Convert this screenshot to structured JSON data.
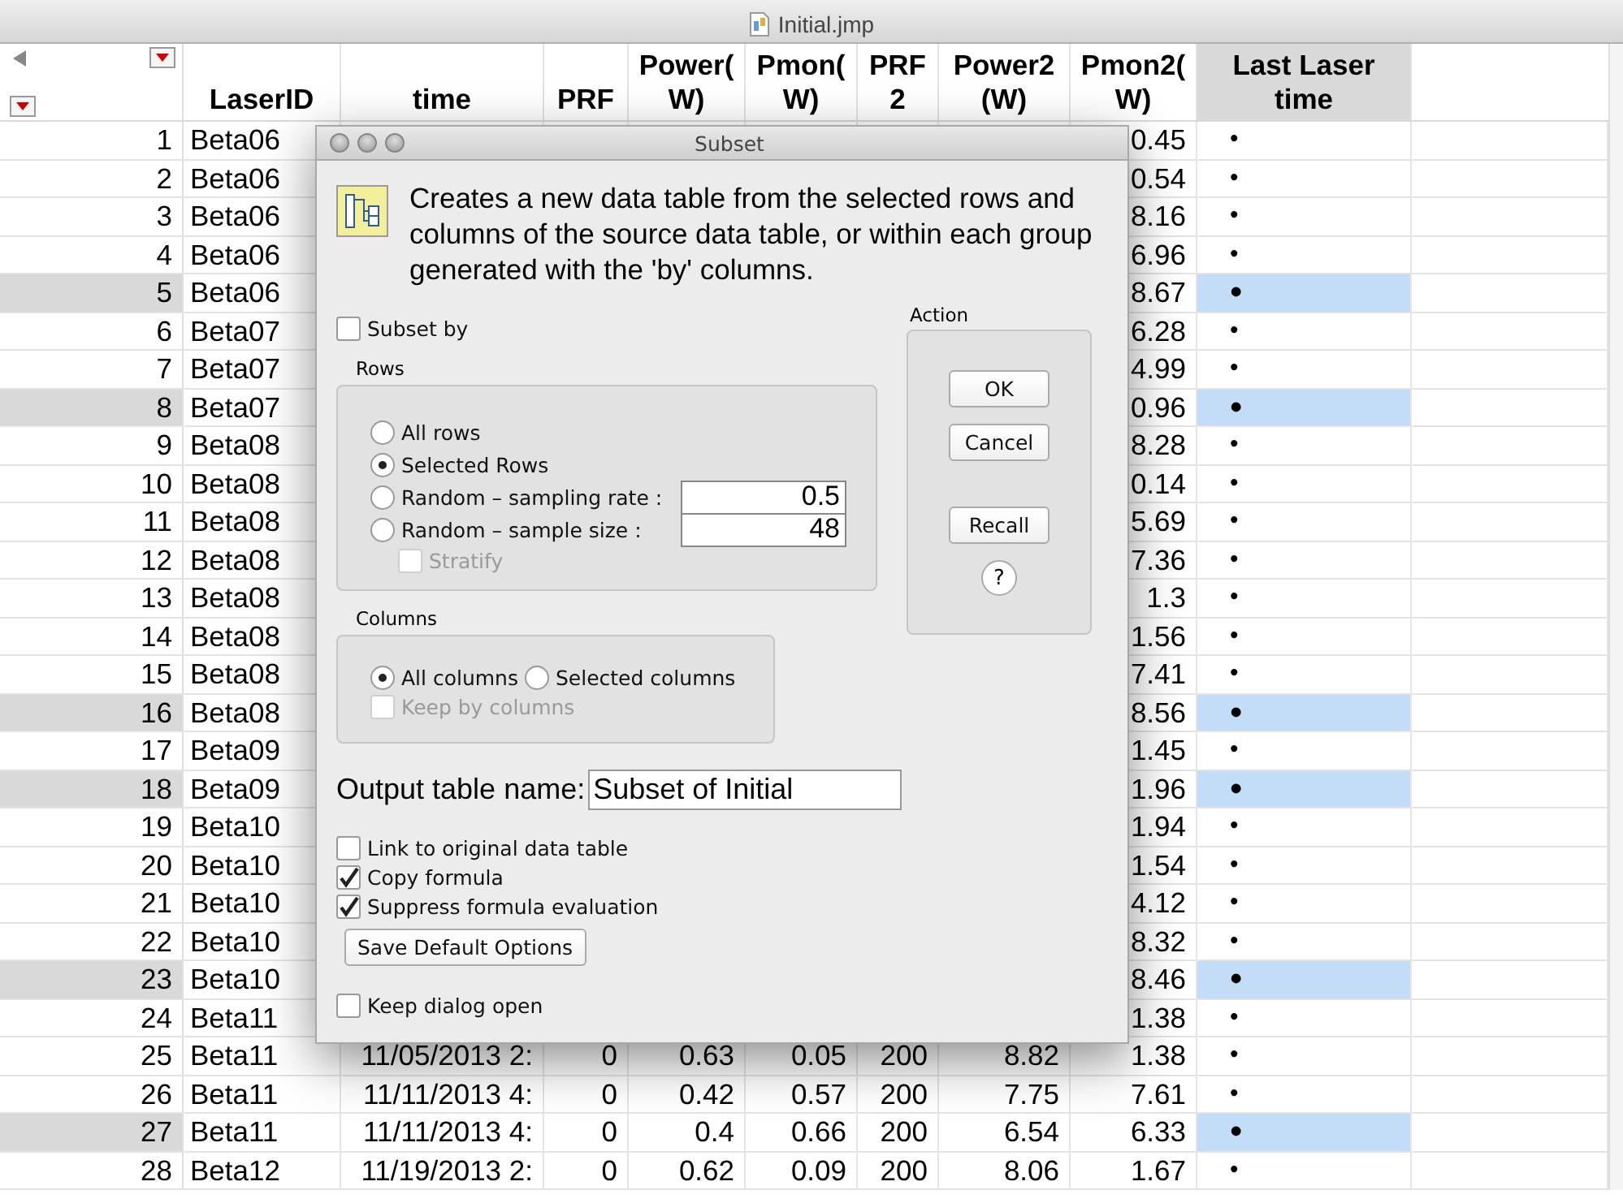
{
  "window": {
    "title": "Initial.jmp"
  },
  "table": {
    "columns": [
      {
        "label": "LaserID",
        "selected": false
      },
      {
        "label": "time",
        "selected": false
      },
      {
        "label": "PRF",
        "selected": false
      },
      {
        "label": "Power(\nW)",
        "selected": false
      },
      {
        "label": "Pmon(\nW)",
        "selected": false
      },
      {
        "label": "PRF\n2",
        "selected": false
      },
      {
        "label": "Power2\n(W)",
        "selected": false
      },
      {
        "label": "Pmon2(\nW)",
        "selected": false
      },
      {
        "label": "Last Laser\ntime",
        "selected": true
      }
    ],
    "rows": [
      {
        "number": "1",
        "laser_id": "Beta06",
        "pmon2": "0.45",
        "last_laser_time": "•",
        "selected": false
      },
      {
        "number": "2",
        "laser_id": "Beta06",
        "pmon2": "0.54",
        "last_laser_time": "•",
        "selected": false
      },
      {
        "number": "3",
        "laser_id": "Beta06",
        "pmon2": "8.16",
        "last_laser_time": "•",
        "selected": false
      },
      {
        "number": "4",
        "laser_id": "Beta06",
        "pmon2": "6.96",
        "last_laser_time": "•",
        "selected": false
      },
      {
        "number": "5",
        "laser_id": "Beta06",
        "pmon2": "8.67",
        "last_laser_time": "•",
        "selected": true
      },
      {
        "number": "6",
        "laser_id": "Beta07",
        "pmon2": "6.28",
        "last_laser_time": "•",
        "selected": false
      },
      {
        "number": "7",
        "laser_id": "Beta07",
        "pmon2": "4.99",
        "last_laser_time": "•",
        "selected": false
      },
      {
        "number": "8",
        "laser_id": "Beta07",
        "pmon2": "0.96",
        "last_laser_time": "•",
        "selected": true
      },
      {
        "number": "9",
        "laser_id": "Beta08",
        "pmon2": "8.28",
        "last_laser_time": "•",
        "selected": false
      },
      {
        "number": "10",
        "laser_id": "Beta08",
        "pmon2": "0.14",
        "last_laser_time": "•",
        "selected": false
      },
      {
        "number": "11",
        "laser_id": "Beta08",
        "pmon2": "5.69",
        "last_laser_time": "•",
        "selected": false
      },
      {
        "number": "12",
        "laser_id": "Beta08",
        "pmon2": "7.36",
        "last_laser_time": "•",
        "selected": false
      },
      {
        "number": "13",
        "laser_id": "Beta08",
        "pmon2": "1.3",
        "last_laser_time": "•",
        "selected": false
      },
      {
        "number": "14",
        "laser_id": "Beta08",
        "pmon2": "1.56",
        "last_laser_time": "•",
        "selected": false
      },
      {
        "number": "15",
        "laser_id": "Beta08",
        "pmon2": "7.41",
        "last_laser_time": "•",
        "selected": false
      },
      {
        "number": "16",
        "laser_id": "Beta08",
        "pmon2": "8.56",
        "last_laser_time": "•",
        "selected": true
      },
      {
        "number": "17",
        "laser_id": "Beta09",
        "pmon2": "1.45",
        "last_laser_time": "•",
        "selected": false
      },
      {
        "number": "18",
        "laser_id": "Beta09",
        "pmon2": "1.96",
        "last_laser_time": "•",
        "selected": true
      },
      {
        "number": "19",
        "laser_id": "Beta10",
        "pmon2": "1.94",
        "last_laser_time": "•",
        "selected": false
      },
      {
        "number": "20",
        "laser_id": "Beta10",
        "pmon2": "1.54",
        "last_laser_time": "•",
        "selected": false
      },
      {
        "number": "21",
        "laser_id": "Beta10",
        "pmon2": "4.12",
        "last_laser_time": "•",
        "selected": false
      },
      {
        "number": "22",
        "laser_id": "Beta10",
        "pmon2": "8.32",
        "last_laser_time": "•",
        "selected": false
      },
      {
        "number": "23",
        "laser_id": "Beta10",
        "pmon2": "8.46",
        "last_laser_time": "•",
        "selected": true
      },
      {
        "number": "24",
        "laser_id": "Beta11",
        "pmon2": "1.38",
        "last_laser_time": "•",
        "selected": false
      },
      {
        "number": "25",
        "laser_id": "Beta11",
        "time": "11/05/2013 2:",
        "prf": "0",
        "power": "0.63",
        "pmon": "0.05",
        "prf2": "200",
        "power2": "8.82",
        "pmon2": "1.38",
        "last_laser_time": "•",
        "selected": false
      },
      {
        "number": "26",
        "laser_id": "Beta11",
        "time": "11/11/2013 4:",
        "prf": "0",
        "power": "0.42",
        "pmon": "0.57",
        "prf2": "200",
        "power2": "7.75",
        "pmon2": "7.61",
        "last_laser_time": "•",
        "selected": false
      },
      {
        "number": "27",
        "laser_id": "Beta11",
        "time": "11/11/2013 4:",
        "prf": "0",
        "power": "0.4",
        "pmon": "0.66",
        "prf2": "200",
        "power2": "6.54",
        "pmon2": "6.33",
        "last_laser_time": "•",
        "selected": true
      },
      {
        "number": "28",
        "laser_id": "Beta12",
        "time": "11/19/2013 2:",
        "prf": "0",
        "power": "0.62",
        "pmon": "0.09",
        "prf2": "200",
        "power2": "8.06",
        "pmon2": "1.67",
        "last_laser_time": "•",
        "selected": false
      }
    ]
  },
  "dialog": {
    "title": "Subset",
    "description": "Creates a new data table from the selected rows and columns of the source data table, or within each group generated with the 'by' columns.",
    "subset_by": {
      "label": "Subset by",
      "checked": false
    },
    "rows_group": {
      "title": "Rows",
      "options": [
        {
          "label": "All rows",
          "selected": false
        },
        {
          "label": "Selected Rows",
          "selected": true
        },
        {
          "label": "Random – sampling rate :",
          "selected": false,
          "value": "0.5"
        },
        {
          "label": "Random – sample size :",
          "selected": false,
          "value": "48"
        }
      ],
      "stratify": {
        "label": "Stratify",
        "checked": false,
        "disabled": true
      }
    },
    "columns_group": {
      "title": "Columns",
      "options": [
        {
          "label": "All columns",
          "selected": true
        },
        {
          "label": "Selected columns",
          "selected": false
        }
      ],
      "keep_by_columns": {
        "label": "Keep by columns",
        "checked": false,
        "disabled": true
      }
    },
    "output_name": {
      "label": "Output table name:",
      "value": "Subset of Initial"
    },
    "options": [
      {
        "label": "Link to original data table",
        "checked": false
      },
      {
        "label": "Copy formula",
        "checked": true
      },
      {
        "label": "Suppress formula evaluation",
        "checked": true
      }
    ],
    "save_button": "Save Default Options",
    "keep_open": {
      "label": "Keep dialog open",
      "checked": false
    },
    "action": {
      "title": "Action",
      "buttons": [
        "OK",
        "Cancel",
        "Recall"
      ],
      "help": "?"
    }
  }
}
